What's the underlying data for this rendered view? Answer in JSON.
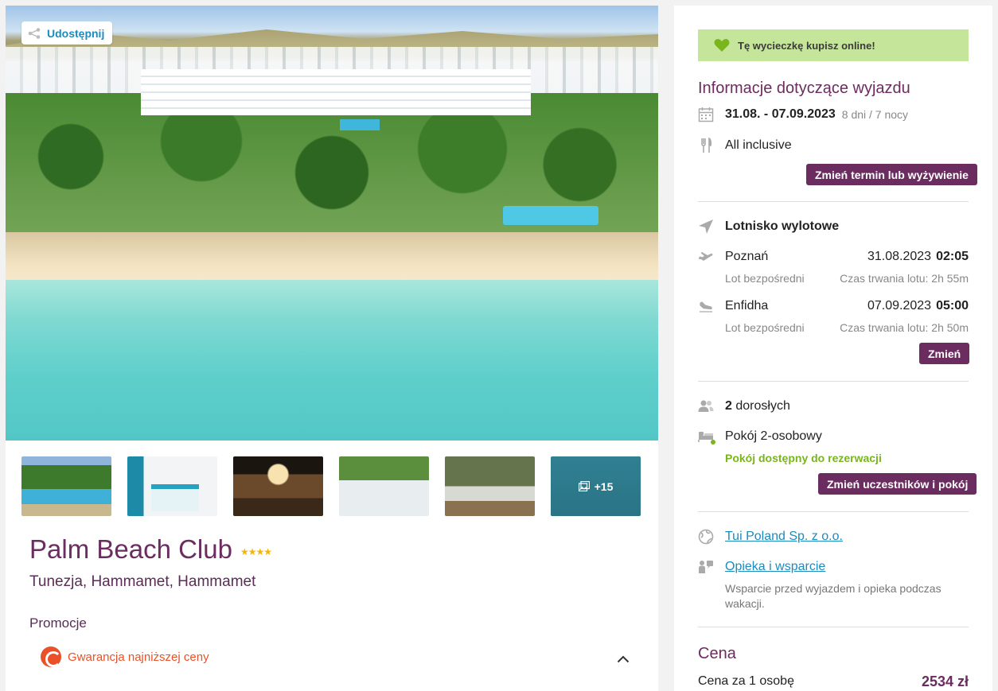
{
  "left": {
    "share_label": "Udostępnij",
    "more_photos": "+15",
    "hotel_name": "Palm Beach Club",
    "stars": "★★★★",
    "location": "Tunezja, Hammamet, Hammamet",
    "promotions_title": "Promocje",
    "promotion_label": "Gwarancja najniższej ceny"
  },
  "right": {
    "online_banner": "Tę wycieczkę kupisz online!",
    "trip_info_title": "Informacje dotyczące wyjazdu",
    "dates": "31.08. - 07.09.2023",
    "duration": "8 dni / 7 nocy",
    "board": "All inclusive",
    "change_date_button": "Zmień termin lub wyżywienie",
    "departure_airport_label": "Lotnisko wylotowe",
    "outbound": {
      "city": "Poznań",
      "date": "31.08.2023",
      "time": "02:05",
      "type": "Lot bezpośredni",
      "duration": "Czas trwania lotu: 2h 55m"
    },
    "return": {
      "city": "Enfidha",
      "date": "07.09.2023",
      "time": "05:00",
      "type": "Lot bezpośredni",
      "duration": "Czas trwania lotu: 2h 50m"
    },
    "change_flight_button": "Zmień",
    "adults_count": "2",
    "adults_label": "dorosłych",
    "room": "Pokój 2-osobowy",
    "room_availability": "Pokój dostępny do rezerwacji",
    "change_participants_button": "Zmień uczestników i pokój",
    "organizer_link": "Tui Poland Sp. z o.o.",
    "support_link": "Opieka i wsparcie",
    "support_desc": "Wsparcie przed wyjazdem i opieka podczas wakacji.",
    "price_title": "Cena",
    "price_per_person_label": "Cena za 1 osobę",
    "price_per_person_value": "2534 zł"
  },
  "colors": {
    "brand_purple": "#6b2c5f",
    "link_blue": "#1a8cbf",
    "success_green": "#7ab51d",
    "banner_green": "#c5e59b",
    "promo_orange": "#e9512a"
  },
  "icons": [
    "share-icon",
    "gallery-icon",
    "chevron-up-icon",
    "heart-icon",
    "calendar-icon",
    "cutlery-icon",
    "plane-departure-icon",
    "plane-takeoff-icon",
    "plane-landing-icon",
    "people-icon",
    "bed-icon",
    "globe-icon",
    "support-icon",
    "promo-icon"
  ]
}
